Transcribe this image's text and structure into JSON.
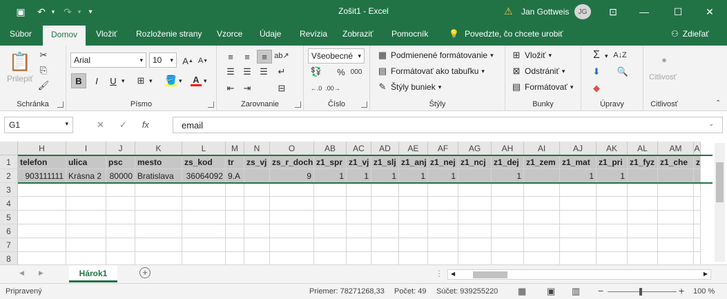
{
  "window": {
    "title": "Zošit1 - Excel",
    "user_name": "Jan Gottweis",
    "user_initials": "JG"
  },
  "quick_access": {
    "save": "💾",
    "undo": "↶",
    "redo": "↷",
    "customize": "▾"
  },
  "tabs": [
    {
      "label": "Súbor"
    },
    {
      "label": "Domov"
    },
    {
      "label": "Vložiť"
    },
    {
      "label": "Rozloženie strany"
    },
    {
      "label": "Vzorce"
    },
    {
      "label": "Údaje"
    },
    {
      "label": "Revízia"
    },
    {
      "label": "Zobraziť"
    },
    {
      "label": "Pomocník"
    }
  ],
  "tell_me": "Povedzte, čo chcete urobiť",
  "share": "Zdieľať",
  "ribbon": {
    "clipboard": {
      "paste": "Prilepiť",
      "label": "Schránka"
    },
    "font": {
      "name": "Arial",
      "size": "10",
      "bold": "B",
      "italic": "I",
      "underline": "U",
      "label": "Písmo"
    },
    "alignment": {
      "label": "Zarovnanie"
    },
    "number": {
      "format": "Všeobecné",
      "label": "Číslo"
    },
    "styles": {
      "conditional": "Podmienené formátovanie",
      "as_table": "Formátovať ako tabuľku",
      "cell_styles": "Štýly buniek",
      "label": "Štýly"
    },
    "cells": {
      "insert": "Vložiť",
      "delete": "Odstrániť",
      "format": "Formátovať",
      "label": "Bunky"
    },
    "editing": {
      "label": "Úpravy"
    },
    "sensitivity": {
      "button": "Citlivosť",
      "label": "Citlivosť"
    }
  },
  "formula_bar": {
    "name_box": "G1",
    "content": "email",
    "fx": "fx"
  },
  "grid": {
    "columns": [
      "H",
      "I",
      "J",
      "K",
      "L",
      "M",
      "N",
      "O",
      "AB",
      "AC",
      "AD",
      "AE",
      "AF",
      "AG",
      "AH",
      "AI",
      "AJ",
      "AK",
      "AL",
      "AM",
      "A"
    ],
    "rows": [
      "1",
      "2",
      "3",
      "4",
      "5",
      "6",
      "7",
      "8"
    ],
    "row1": [
      "telefon",
      "ulica",
      "psc",
      "mesto",
      "zs_kod",
      "tr",
      "zs_vj",
      "zs_r_doch",
      "z1_spr",
      "z1_vj",
      "z1_slj",
      "z1_anj",
      "z1_nej",
      "z1_ncj",
      "z1_dej",
      "z1_zem",
      "z1_mat",
      "z1_pri",
      "z1_fyz",
      "z1_che",
      "z"
    ],
    "row2": [
      "903111111",
      "Krásna 2",
      "80000",
      "Bratislava",
      "36064092",
      "9.A",
      "",
      "9",
      "1",
      "1",
      "1",
      "1",
      "1",
      "",
      "1",
      "",
      "1",
      "1",
      "",
      "",
      ""
    ]
  },
  "sheet": {
    "name": "Hárok1",
    "add": "+"
  },
  "status": {
    "ready": "Pripravený",
    "average": "Priemer: 78271268,33",
    "count": "Počet: 49",
    "sum": "Súčet: 939255220",
    "zoom": "100 %"
  }
}
